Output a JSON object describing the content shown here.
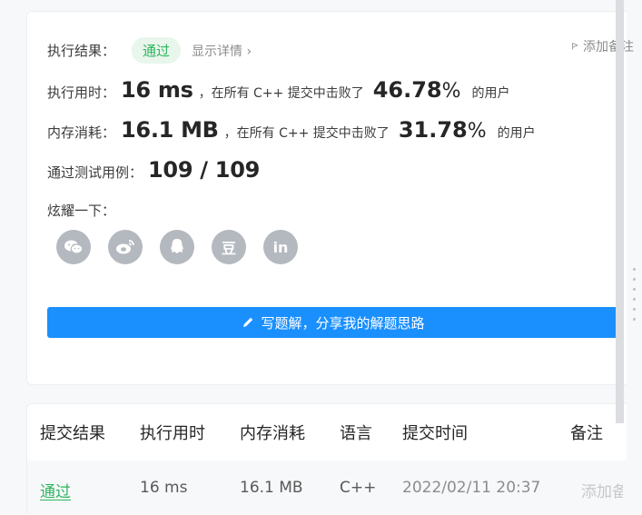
{
  "result": {
    "label": "执行结果：",
    "status": "通过",
    "detail_link": "显示详情",
    "add_note": "添加备注"
  },
  "runtime": {
    "label": "执行用时：",
    "value": "16 ms",
    "text": "，在所有 C++ 提交中击败了",
    "percent": "46.78",
    "percent_sign": "%",
    "suffix": "的用户"
  },
  "memory": {
    "label": "内存消耗：",
    "value": "16.1 MB",
    "text": "，在所有 C++ 提交中击败了",
    "percent": "31.78",
    "percent_sign": "%",
    "suffix": "的用户"
  },
  "testcases": {
    "label": "通过测试用例：",
    "value": "109 / 109"
  },
  "share": {
    "label": "炫耀一下：",
    "icons": [
      "wechat-icon",
      "weibo-icon",
      "qq-icon",
      "douban-icon",
      "linkedin-icon"
    ],
    "douban_glyph": "豆",
    "linkedin_glyph": "in"
  },
  "write_button": {
    "label": "写题解，分享我的解题思路"
  },
  "submissions": {
    "headers": [
      "提交结果",
      "执行用时",
      "内存消耗",
      "语言",
      "提交时间",
      "备注"
    ],
    "rows": [
      {
        "result": "通过",
        "runtime": "16 ms",
        "memory": "16.1 MB",
        "language": "C++",
        "time": "2022/02/11 20:37",
        "note": "添加备注"
      }
    ]
  },
  "colors": {
    "accent": "#1a90ff",
    "success": "#2db55d",
    "success_bg": "#e8f6ec",
    "icon_gray": "#b4b8bf"
  }
}
